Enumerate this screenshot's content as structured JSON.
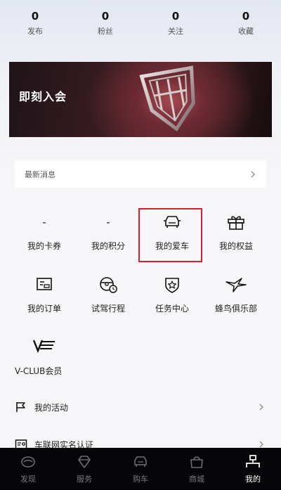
{
  "stats": [
    {
      "value": "0",
      "label": "发布"
    },
    {
      "value": "0",
      "label": "粉丝"
    },
    {
      "value": "0",
      "label": "关注"
    },
    {
      "value": "0",
      "label": "收藏"
    }
  ],
  "banner": {
    "title": "即刻入会"
  },
  "news": {
    "label": "最新消息"
  },
  "grid": {
    "row1": [
      {
        "value": "-",
        "label": "我的卡券"
      },
      {
        "value": "-",
        "label": "我的积分"
      },
      {
        "icon": "car-icon",
        "label": "我的爱车"
      },
      {
        "icon": "gift-icon",
        "label": "我的权益"
      }
    ],
    "row2": [
      {
        "icon": "order-icon",
        "label": "我的订单"
      },
      {
        "icon": "steering-wheel-clock-icon",
        "label": "试驾行程"
      },
      {
        "icon": "shield-star-icon",
        "label": "任务中心"
      },
      {
        "icon": "hummingbird-icon",
        "label": "蜂鸟俱乐部"
      }
    ],
    "row3": [
      {
        "icon": "vclub-icon",
        "label": "V-CLUB会员"
      }
    ]
  },
  "list": [
    {
      "icon": "flag-icon",
      "label": "我的活动"
    },
    {
      "icon": "id-card-icon",
      "label": "车联网实名认证"
    }
  ],
  "tabbar": [
    {
      "icon": "discover-icon",
      "label": "发现"
    },
    {
      "icon": "diamond-icon",
      "label": "服务"
    },
    {
      "icon": "car-front-icon",
      "label": "购车"
    },
    {
      "icon": "bag-icon",
      "label": "商城"
    },
    {
      "icon": "profile-icon",
      "label": "我的",
      "active": true
    }
  ],
  "colors": {
    "highlight": "#d32030",
    "tabbar_bg": "#060608",
    "active_tab": "#ffffff"
  }
}
